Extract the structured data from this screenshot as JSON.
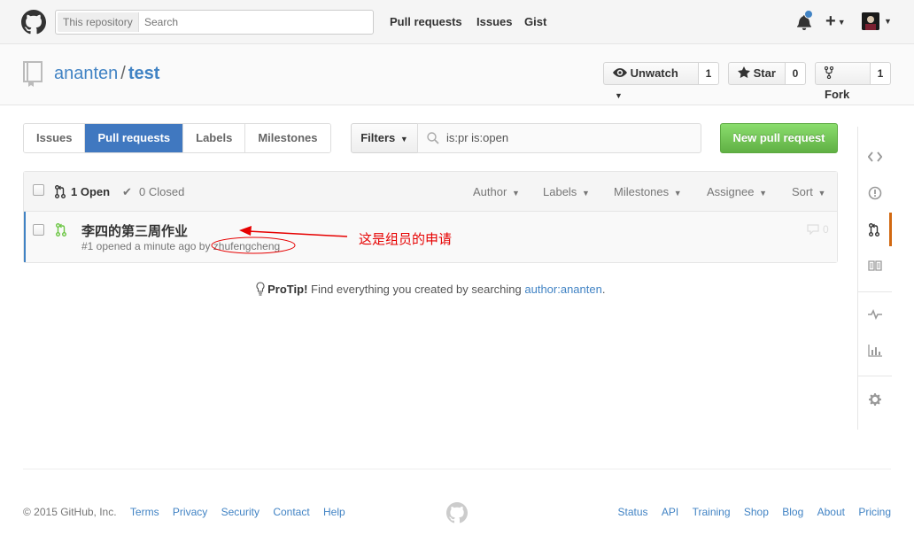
{
  "header": {
    "search_scope": "This repository",
    "search_placeholder": "Search",
    "nav": [
      "Pull requests",
      "Issues",
      "Gist"
    ]
  },
  "repo": {
    "owner": "ananten",
    "separator": "/",
    "name": "test",
    "unwatch_label": "Unwatch",
    "unwatch_count": "1",
    "star_label": "Star",
    "star_count": "0",
    "fork_label": "Fork",
    "fork_count": "1"
  },
  "subnav": {
    "issues": "Issues",
    "pull_requests": "Pull requests",
    "labels": "Labels",
    "milestones": "Milestones",
    "filters": "Filters",
    "filter_query": "is:pr is:open",
    "new_pr": "New pull request"
  },
  "list": {
    "open": "1 Open",
    "closed": "0 Closed",
    "filters": [
      "Author",
      "Labels",
      "Milestones",
      "Assignee",
      "Sort"
    ],
    "items": [
      {
        "title": "李四的第三周作业",
        "meta_prefix": "#1 opened a minute ago by ",
        "author": "zhufengcheng",
        "comments": "0"
      }
    ]
  },
  "protip": {
    "label": "ProTip!",
    "text": " Find everything you created by searching ",
    "link": "author:ananten",
    "end": "."
  },
  "annotation": {
    "text": "这是组员的申请",
    "color": "#e60000"
  },
  "footer": {
    "copyright": "© 2015 GitHub, Inc.",
    "left_links": [
      "Terms",
      "Privacy",
      "Security",
      "Contact",
      "Help"
    ],
    "right_links": [
      "Status",
      "API",
      "Training",
      "Shop",
      "Blog",
      "About",
      "Pricing"
    ]
  },
  "colors": {
    "accent": "#4078c0",
    "link": "#4183c4",
    "green": "#6cc644",
    "sidebar_active": "#d26911"
  }
}
